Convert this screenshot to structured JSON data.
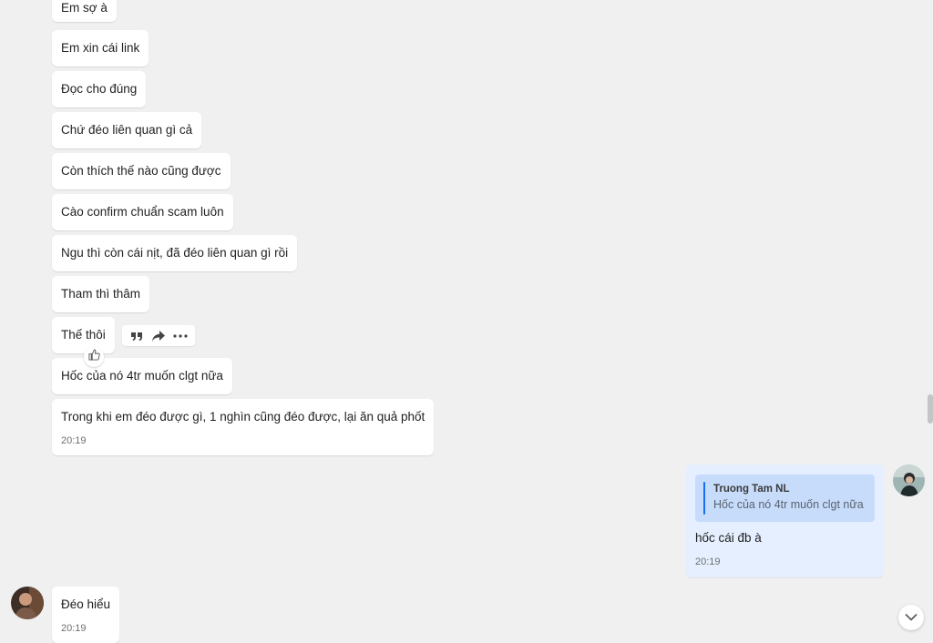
{
  "incoming_messages": [
    {
      "text": "Em sợ à"
    },
    {
      "text": "Em xin cái link"
    },
    {
      "text": "Đọc cho đúng"
    },
    {
      "text": "Chứ đéo liên quan gì cả"
    },
    {
      "text": "Còn thích thế nào cũng được"
    },
    {
      "text": "Cào confirm chuẩn scam luôn"
    },
    {
      "text": "Ngu thì còn cái nịt, đã đéo liên quan gì rồi"
    },
    {
      "text": "Tham thì thâm"
    },
    {
      "text": "Thế thôi"
    },
    {
      "text": "Hốc của nó 4tr muốn clgt nữa"
    },
    {
      "text": "Trong khi em đéo được gì, 1 nghìn cũng đéo được, lại ăn quả phốt",
      "time": "20:19"
    }
  ],
  "outgoing_message": {
    "quote_author": "Truong Tam NL",
    "quote_text": "Hốc của nó 4tr muốn clgt nữa",
    "text": "hốc cái đb à",
    "time": "20:19"
  },
  "last_incoming": {
    "text": "Đéo hiểu",
    "time": "20:19"
  },
  "message_actions": {
    "icons": [
      "quote-icon",
      "forward-icon",
      "more-icon"
    ],
    "like_icon": "thumbs-up-icon"
  },
  "colors": {
    "background": "#f0f0f0",
    "incoming_bubble": "#ffffff",
    "outgoing_bubble": "#e5efff",
    "quote_background": "#c7dcfb",
    "accent": "#1a6ef5"
  }
}
